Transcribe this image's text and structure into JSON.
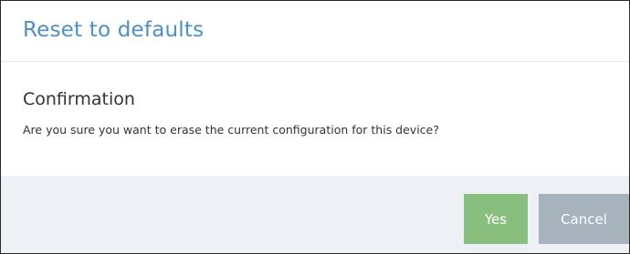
{
  "dialog": {
    "title": "Reset to defaults",
    "heading": "Confirmation",
    "message": "Are you sure you want to erase the current configuration for this device?",
    "buttons": {
      "yes_label": "Yes",
      "cancel_label": "Cancel"
    }
  },
  "colors": {
    "title": "#4a8fcf",
    "yes_button": "#88bf7e",
    "cancel_button": "#a6b3bd",
    "footer_background": "#edf1f5"
  }
}
